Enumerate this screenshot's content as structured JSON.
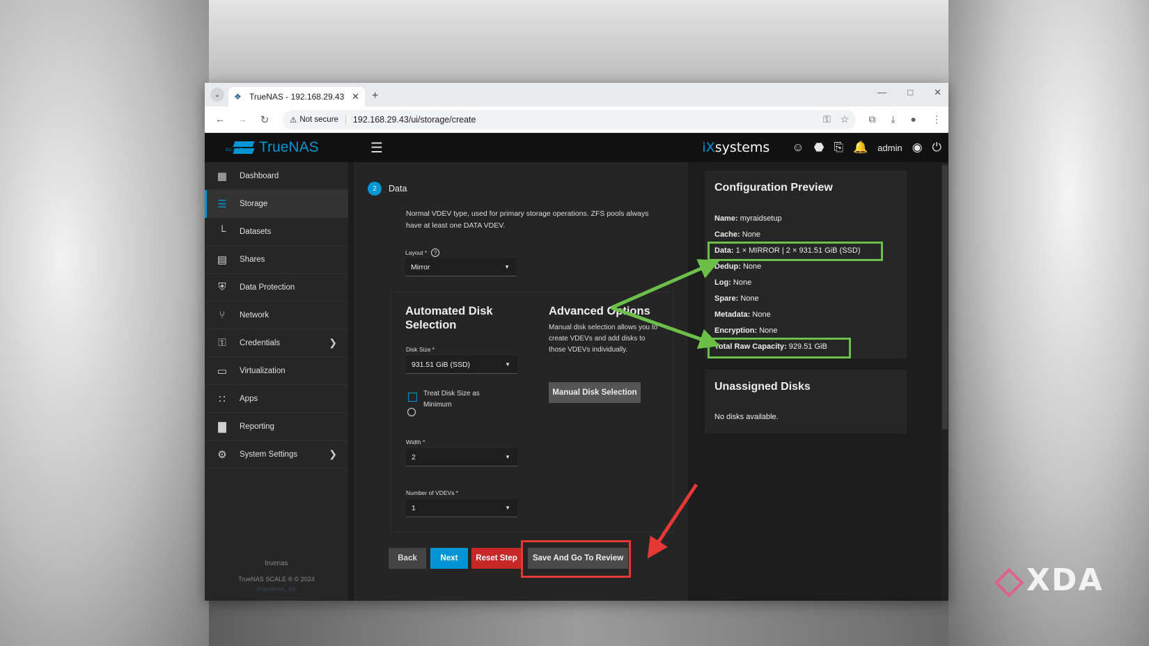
{
  "watermark": "XDA",
  "browser": {
    "tab_title": "TrueNAS - 192.168.29.43",
    "not_secure": "Not secure",
    "url": "192.168.29.43/ui/storage/create"
  },
  "app": {
    "logo": "TrueNAS",
    "logo_sub": "SCALE",
    "brand_ix": "iX",
    "brand_systems": "systems",
    "user": "admin"
  },
  "sidebar": {
    "items": [
      {
        "label": "Dashboard",
        "icon": "dashboard-icon"
      },
      {
        "label": "Storage",
        "icon": "storage-icon"
      },
      {
        "label": "Datasets",
        "icon": "datasets-icon"
      },
      {
        "label": "Shares",
        "icon": "shares-icon"
      },
      {
        "label": "Data Protection",
        "icon": "shield-icon"
      },
      {
        "label": "Network",
        "icon": "network-icon"
      },
      {
        "label": "Credentials",
        "icon": "key-icon"
      },
      {
        "label": "Virtualization",
        "icon": "monitor-icon"
      },
      {
        "label": "Apps",
        "icon": "apps-grid-icon"
      },
      {
        "label": "Reporting",
        "icon": "chart-icon"
      },
      {
        "label": "System Settings",
        "icon": "gear-icon"
      }
    ],
    "hostname": "truenas",
    "copyright": "TrueNAS SCALE ® © 2024",
    "company": "iXsystems, Inc"
  },
  "wizard": {
    "step_number": "2",
    "step_title": "Data",
    "description": "Normal VDEV type, used for primary storage operations. ZFS pools always have at least one DATA VDEV.",
    "layout_label": "Layout *",
    "layout_value": "Mirror",
    "auto_title": "Automated Disk Selection",
    "disk_size_label": "Disk Size *",
    "disk_size_value": "931.51 GiB (SSD)",
    "treat_min_label": "Treat Disk Size as Minimum",
    "width_label": "Width *",
    "width_value": "2",
    "vdevs_label": "Number of VDEVs *",
    "vdevs_value": "1",
    "advanced_title": "Advanced Options",
    "advanced_desc": "Manual disk selection allows you to create VDEVs and add disks to those VDEVs individually.",
    "manual_button": "Manual Disk Selection",
    "back": "Back",
    "next": "Next",
    "reset": "Reset Step",
    "save": "Save And Go To Review"
  },
  "preview": {
    "title": "Configuration Preview",
    "rows": [
      {
        "k": "Name:",
        "v": "myraidsetup"
      },
      {
        "k": "Cache:",
        "v": "None"
      },
      {
        "k": "Data:",
        "v": "1 × MIRROR | 2 × 931.51 GiB (SSD)"
      },
      {
        "k": "Dedup:",
        "v": "None"
      },
      {
        "k": "Log:",
        "v": "None"
      },
      {
        "k": "Spare:",
        "v": "None"
      },
      {
        "k": "Metadata:",
        "v": "None"
      },
      {
        "k": "Encryption:",
        "v": "None"
      },
      {
        "k": "Total Raw Capacity:",
        "v": "929.51 GiB"
      }
    ]
  },
  "unassigned": {
    "title": "Unassigned Disks",
    "empty": "No disks available."
  },
  "colors": {
    "accent": "#0095d5",
    "highlight_green": "#6cc04a",
    "highlight_red": "#e53935",
    "reset_red": "#c62828"
  }
}
